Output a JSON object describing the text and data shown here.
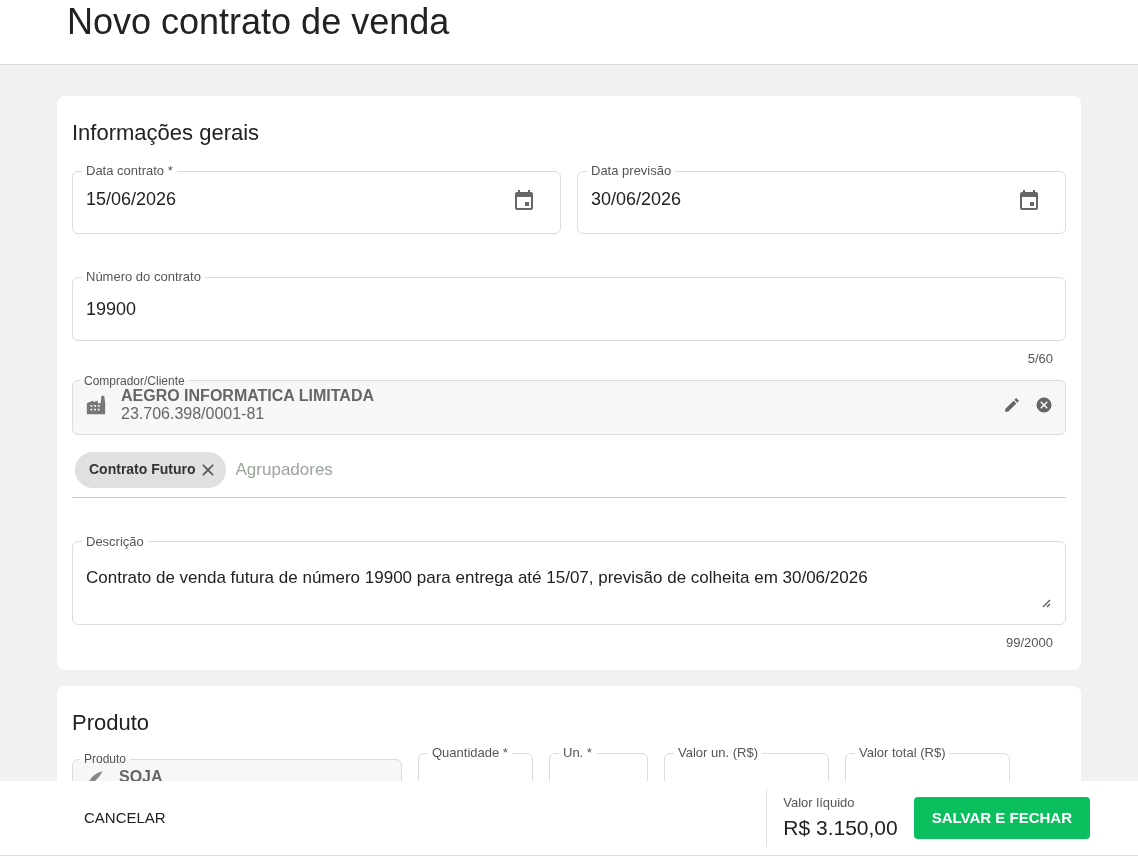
{
  "page_title": "Novo contrato de venda",
  "general": {
    "title": "Informações gerais",
    "date_fields": [
      {
        "label": "Data contrato *",
        "value": "15/06/2026"
      },
      {
        "label": "Data previsão",
        "value": "30/06/2026"
      }
    ],
    "contract_number": {
      "label": "Número do contrato",
      "value": "19900",
      "counter": "5/60"
    },
    "buyer": {
      "label": "Comprador/Cliente",
      "name": "AEGRO INFORMATICA LIMITADA",
      "document": "23.706.398/0001-81"
    },
    "groupers": {
      "chips": [
        "Contrato Futuro"
      ],
      "placeholder": "Agrupadores"
    },
    "description": {
      "label": "Descrição",
      "value": "Contrato de venda futura de número 19900 para entrega até 15/07, previsão de colheita em 30/06/2026",
      "counter": "99/2000"
    }
  },
  "product": {
    "title": "Produto",
    "product_label": "Produto",
    "product_value": "SOJA",
    "fields": [
      {
        "label": "Quantidade *"
      },
      {
        "label": "Un. *"
      },
      {
        "label": "Valor un. (R$)"
      },
      {
        "label": "Valor total (R$)"
      }
    ]
  },
  "footer": {
    "cancel": "CANCELAR",
    "net_label": "Valor líquido",
    "net_value": "R$ 3.150,00",
    "save": "SALVAR E FECHAR"
  }
}
